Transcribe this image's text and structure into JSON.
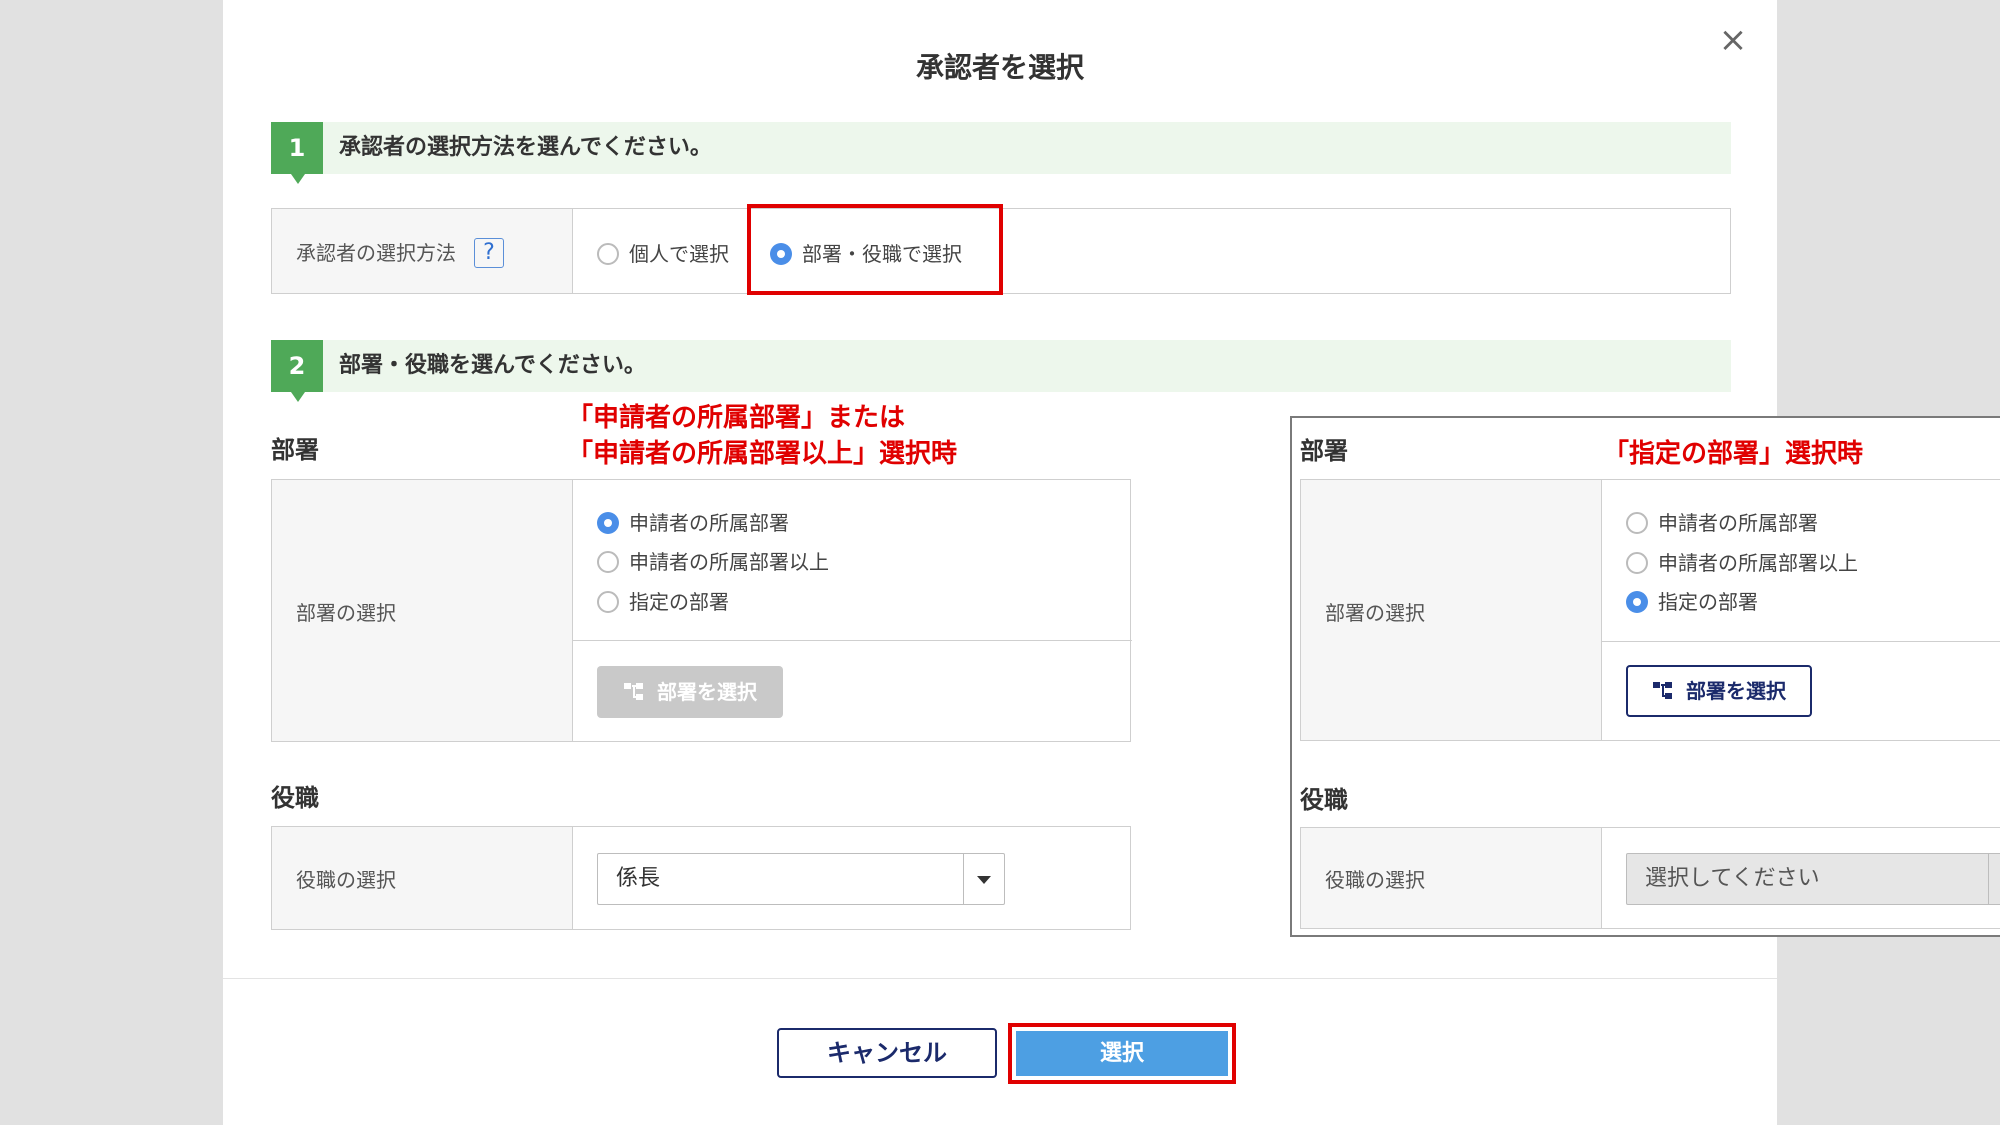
{
  "dialog": {
    "title": "承認者を選択",
    "close_symbol": "×"
  },
  "step1": {
    "number": "1",
    "text": "承認者の選択方法を選んでください。",
    "row_label": "承認者の選択方法",
    "help_symbol": "?",
    "options": [
      {
        "label": "個人で選択",
        "selected": false
      },
      {
        "label": "部署・役職で選択",
        "selected": true
      }
    ]
  },
  "step2": {
    "number": "2",
    "text": "部署・役職を選んでください。"
  },
  "left_panel": {
    "annotation": [
      "「申請者の所属部署」または",
      "「申請者の所属部署以上」選択時"
    ],
    "department_heading": "部署",
    "department_row_label": "部署の選択",
    "department_options": [
      {
        "label": "申請者の所属部署",
        "selected": true
      },
      {
        "label": "申請者の所属部署以上",
        "selected": false
      },
      {
        "label": "指定の部署",
        "selected": false
      }
    ],
    "select_department_button": "部署を選択",
    "position_heading": "役職",
    "position_row_label": "役職の選択",
    "position_value": "係長"
  },
  "right_panel": {
    "annotation": "「指定の部署」選択時",
    "department_heading": "部署",
    "department_row_label": "部署の選択",
    "department_options": [
      {
        "label": "申請者の所属部署",
        "selected": false
      },
      {
        "label": "申請者の所属部署以上",
        "selected": false
      },
      {
        "label": "指定の部署",
        "selected": true
      }
    ],
    "select_department_button": "部署を選択",
    "position_heading": "役職",
    "position_row_label": "役職の選択",
    "position_placeholder": "選択してください"
  },
  "footer": {
    "cancel_label": "キャンセル",
    "select_label": "選択"
  },
  "colors": {
    "accent_green": "#4fa958",
    "step_bg": "#edf7ec",
    "radio_blue": "#4a8ee8",
    "primary_button": "#4d9fe3",
    "highlight_red": "#e00000",
    "outline_navy": "#1b2a6b"
  },
  "icons": [
    "close-icon",
    "help-icon",
    "org-tree-icon",
    "dropdown-arrow-icon"
  ]
}
